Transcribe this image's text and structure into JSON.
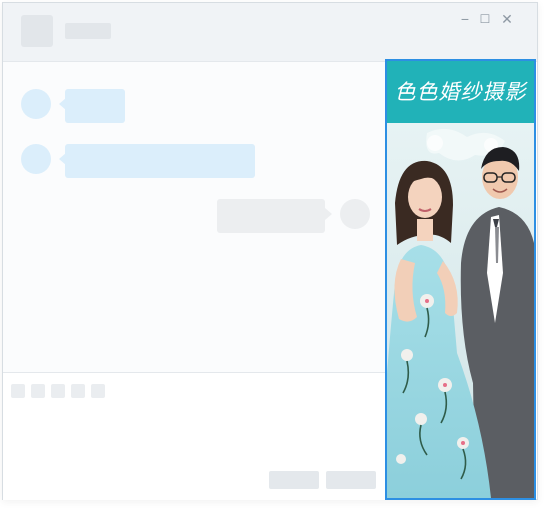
{
  "window": {
    "controls": {
      "minimize": "−",
      "maximize": "☐",
      "close": "✕"
    }
  },
  "ad": {
    "banner_text": "色色婚纱摄影"
  },
  "colors": {
    "incoming_bubble": "#dbeefb",
    "outgoing_bubble": "#eceef0",
    "ad_banner": "#21b2b8",
    "ad_border": "#2d8fe3"
  },
  "icons": [
    "minimize-icon",
    "maximize-icon",
    "close-icon"
  ]
}
